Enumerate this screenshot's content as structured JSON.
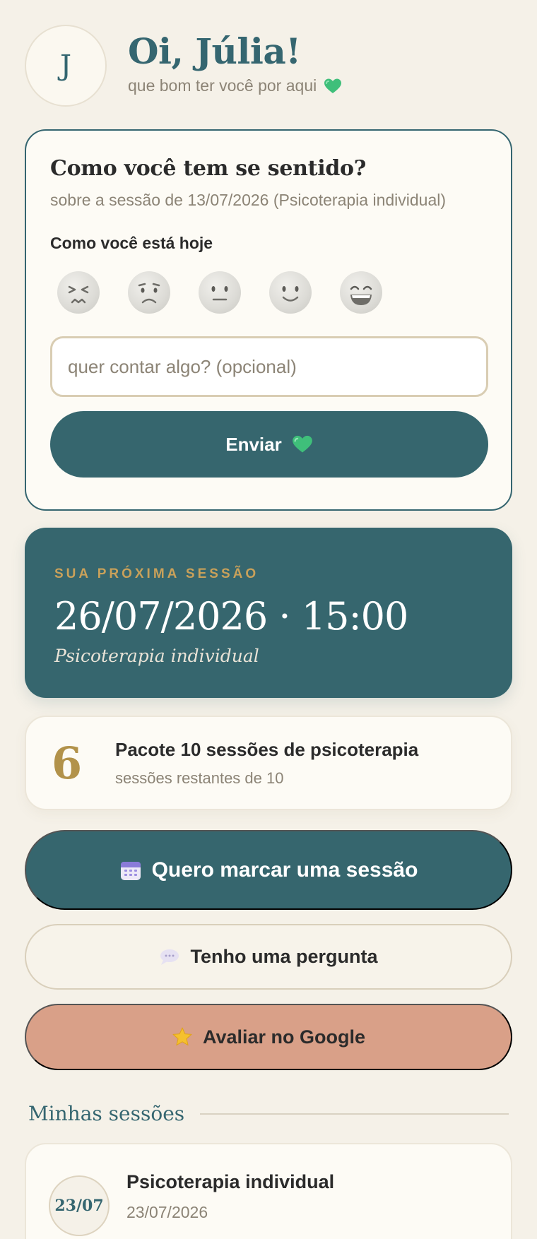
{
  "header": {
    "avatar_initial": "J",
    "title": "Oi, Júlia!",
    "subtitle": "que bom ter você por aqui",
    "subtitle_icon": "green-heart-icon"
  },
  "feedback": {
    "title": "Como você tem se sentido?",
    "subtitle": "sobre a sessão de 13/07/2026 (Psicoterapia individual)",
    "mood_label": "Como você está hoje",
    "moods": [
      "very-sad-face-icon",
      "sad-face-icon",
      "neutral-face-icon",
      "smile-face-icon",
      "big-smile-face-icon"
    ],
    "input_placeholder": "quer contar algo? (opcional)",
    "send_label": "Enviar"
  },
  "next_session": {
    "label": "SUA PRÓXIMA SESSÃO",
    "datetime": "26/07/2026 · 15:00",
    "type": "Psicoterapia individual"
  },
  "package": {
    "remaining": "6",
    "title": "Pacote 10 sessões de psicoterapia",
    "subtitle": "sessões restantes de 10"
  },
  "actions": {
    "book_label": "Quero marcar uma sessão",
    "book_icon": "calendar-icon",
    "question_label": "Tenho uma pergunta",
    "question_icon": "speech-bubble-icon",
    "google_label": "Avaliar no Google",
    "google_icon": "star-icon"
  },
  "sessions": {
    "heading": "Minhas sessões",
    "items": [
      {
        "badge": "23/07",
        "title": "Psicoterapia individual",
        "date": "23/07/2026"
      }
    ]
  },
  "colors": {
    "background": "#F5F1E8",
    "primary": "#36666E",
    "accent_gold": "#B2924A",
    "google_button": "#D9A088"
  }
}
